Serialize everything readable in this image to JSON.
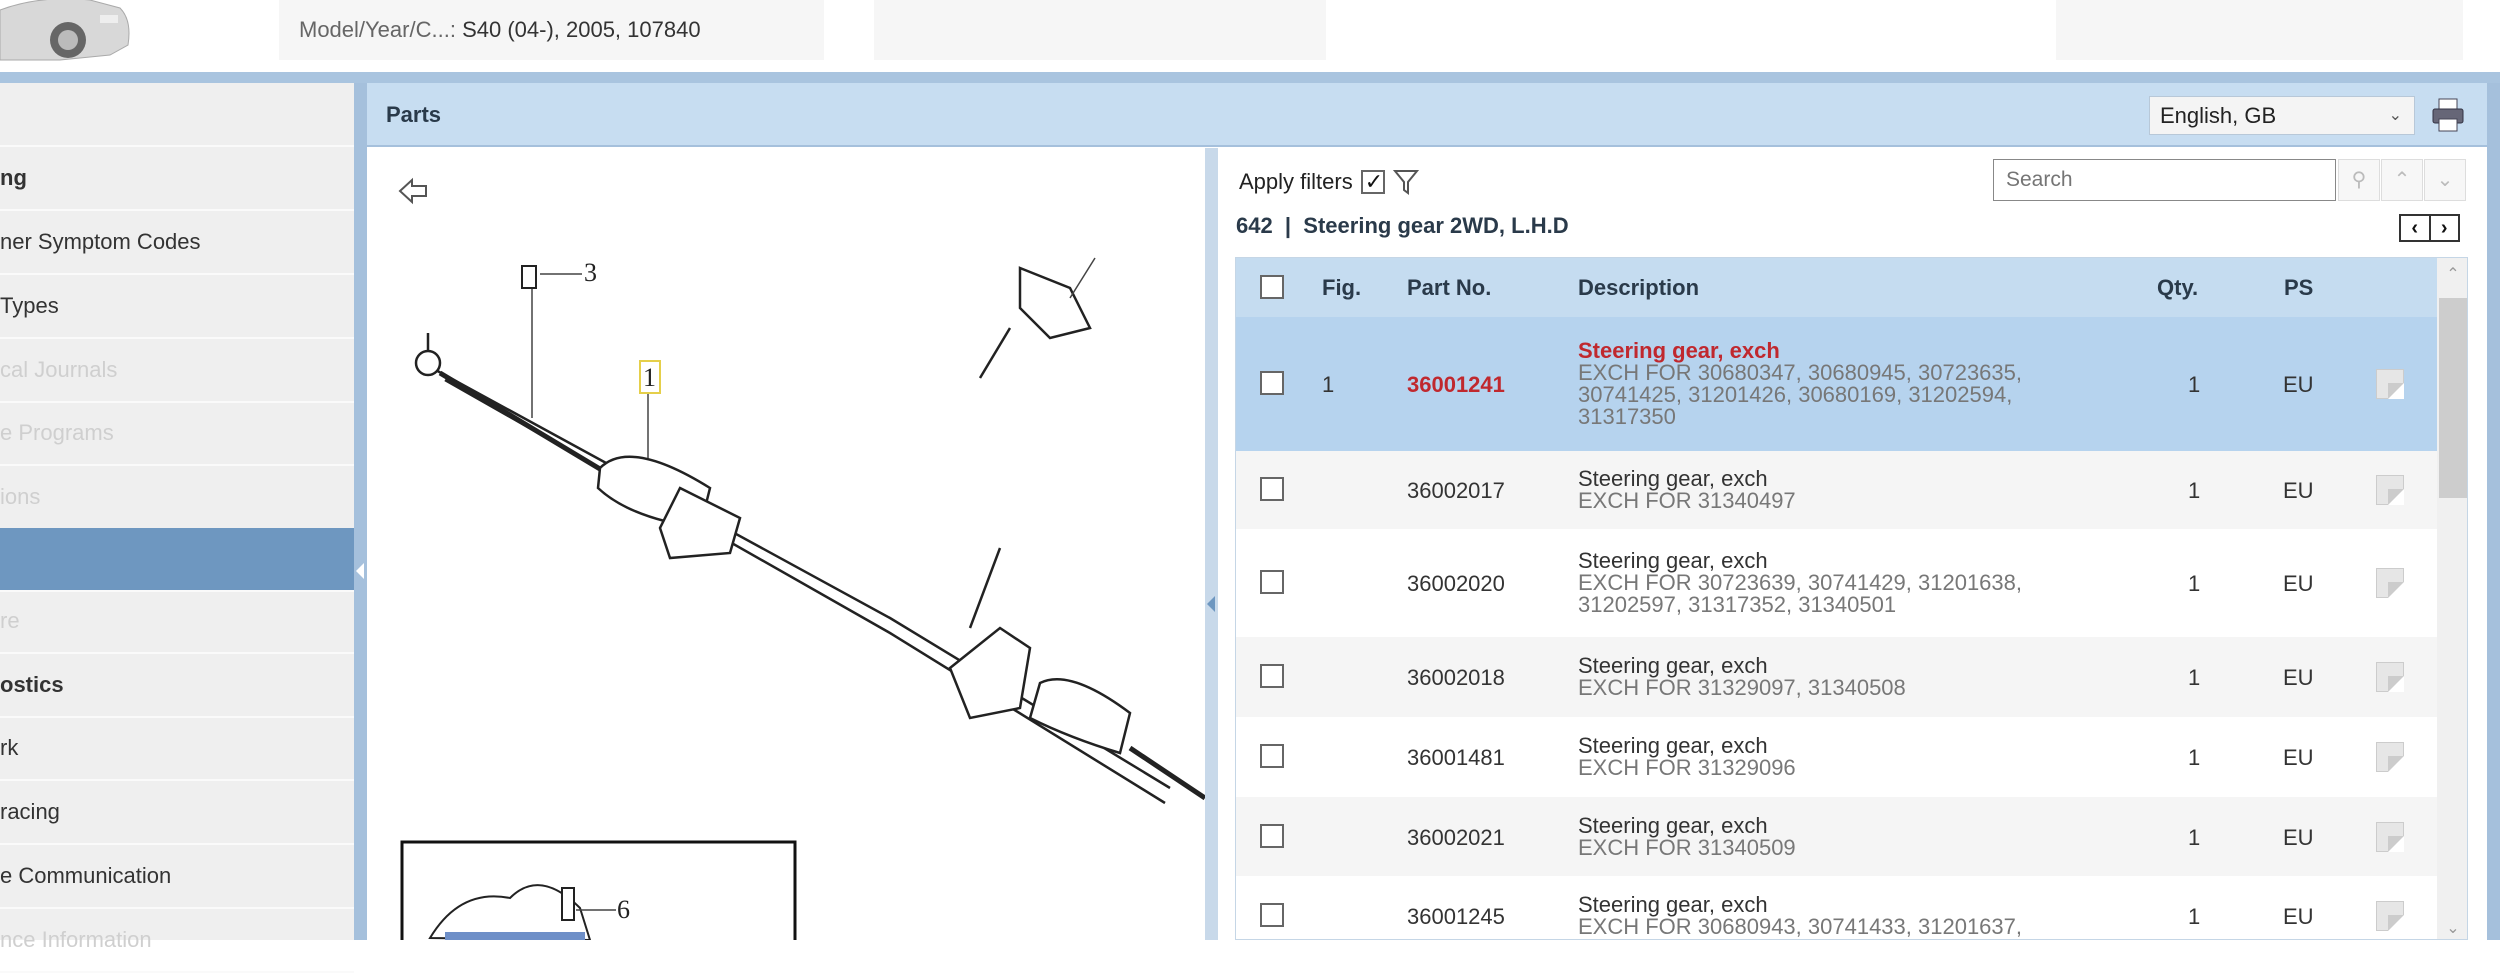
{
  "header": {
    "model_label": "Model/Year/C...:",
    "model_value": "S40 (04-), 2005, 107840"
  },
  "sidebar": {
    "items": [
      {
        "label": "",
        "state": "normal"
      },
      {
        "label": "ng",
        "state": "bold"
      },
      {
        "label": "ner Symptom Codes",
        "state": "normal"
      },
      {
        "label": "Types",
        "state": "normal"
      },
      {
        "label": "cal Journals",
        "state": "disabled"
      },
      {
        "label": "e Programs",
        "state": "disabled"
      },
      {
        "label": "ions",
        "state": "disabled"
      },
      {
        "label": "",
        "state": "selected"
      },
      {
        "label": "re",
        "state": "disabled"
      },
      {
        "label": "ostics",
        "state": "bold"
      },
      {
        "label": "rk",
        "state": "normal"
      },
      {
        "label": "racing",
        "state": "normal"
      },
      {
        "label": "e Communication",
        "state": "normal"
      },
      {
        "label": "nce Information",
        "state": "disabled"
      }
    ]
  },
  "panel": {
    "title": "Parts",
    "language": "English, GB"
  },
  "diagram": {
    "callouts": [
      "3",
      "1",
      "6"
    ]
  },
  "parts": {
    "apply_filters_label": "Apply filters",
    "apply_filters_checked": true,
    "search_placeholder": "Search",
    "group_title": "642  |  Steering gear 2WD, L.H.D",
    "columns": {
      "fig": "Fig.",
      "part_no": "Part No.",
      "description": "Description",
      "qty": "Qty.",
      "ps": "PS"
    },
    "rows": [
      {
        "fig": "1",
        "part_no": "36001241",
        "desc1": "Steering gear, exch",
        "desc2": "EXCH FOR 30680347, 30680945, 30723635,\n30741425, 31201426, 30680169, 31202594,\n31317350",
        "qty": "1",
        "ps": "EU",
        "selected": true
      },
      {
        "fig": "",
        "part_no": "36002017",
        "desc1": "Steering gear, exch",
        "desc2": "EXCH FOR 31340497",
        "qty": "1",
        "ps": "EU"
      },
      {
        "fig": "",
        "part_no": "36002020",
        "desc1": "Steering gear, exch",
        "desc2": "EXCH FOR 30723639, 30741429, 31201638,\n31202597, 31317352, 31340501",
        "qty": "1",
        "ps": "EU"
      },
      {
        "fig": "",
        "part_no": "36002018",
        "desc1": "Steering gear, exch",
        "desc2": "EXCH FOR 31329097, 31340508",
        "qty": "1",
        "ps": "EU"
      },
      {
        "fig": "",
        "part_no": "36001481",
        "desc1": "Steering gear, exch",
        "desc2": "EXCH FOR 31329096",
        "qty": "1",
        "ps": "EU"
      },
      {
        "fig": "",
        "part_no": "36002021",
        "desc1": "Steering gear, exch",
        "desc2": "EXCH FOR 31340509",
        "qty": "1",
        "ps": "EU"
      },
      {
        "fig": "",
        "part_no": "36001245",
        "desc1": "Steering gear, exch",
        "desc2": "EXCH FOR 30680943, 30741433, 31201637,",
        "qty": "1",
        "ps": "EU"
      }
    ]
  },
  "colors": {
    "accent": "#6e97c0",
    "header_bg": "#c7ddf1",
    "selected_row": "#b6d3ee",
    "highlight_text": "#c0282e"
  }
}
